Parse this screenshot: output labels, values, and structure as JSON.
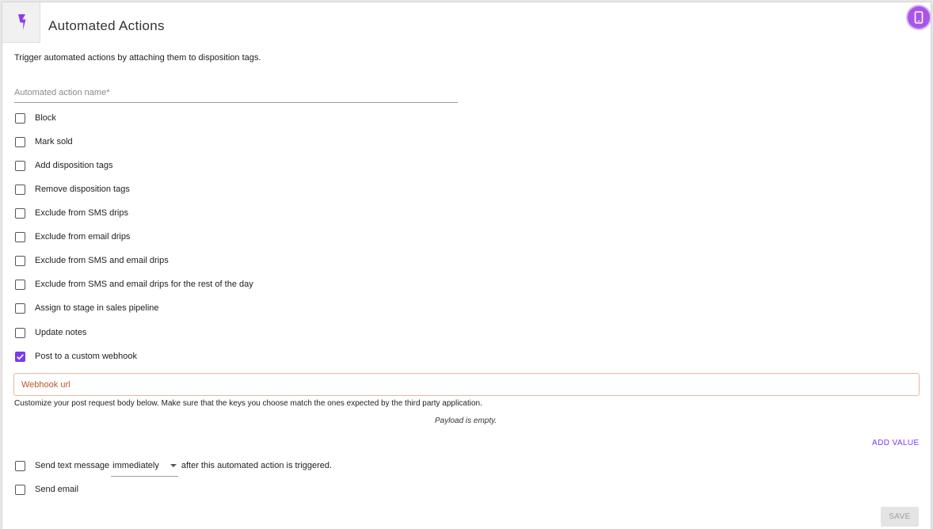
{
  "header": {
    "title": "Automated Actions",
    "icon": "lightning-bolt-icon",
    "phone_icon": "mobile-phone-icon",
    "accent_color": "#7c3aed"
  },
  "description": "Trigger automated actions by attaching them to disposition tags.",
  "name_field": {
    "placeholder": "Automated action name",
    "required_marker": "*"
  },
  "options": [
    {
      "label": "Block",
      "checked": false
    },
    {
      "label": "Mark sold",
      "checked": false
    },
    {
      "label": "Add disposition tags",
      "checked": false
    },
    {
      "label": "Remove disposition tags",
      "checked": false
    },
    {
      "label": "Exclude from SMS drips",
      "checked": false
    },
    {
      "label": "Exclude from email drips",
      "checked": false
    },
    {
      "label": "Exclude from SMS and email drips",
      "checked": false
    },
    {
      "label": "Exclude from SMS and email drips for the rest of the day",
      "checked": false
    },
    {
      "label": "Assign to stage in sales pipeline",
      "checked": false
    },
    {
      "label": "Update notes",
      "checked": false
    },
    {
      "label": "Post to a custom webhook",
      "checked": true
    }
  ],
  "webhook": {
    "placeholder": "Webhook url",
    "hint": "Customize your post request body below. Make sure that the keys you choose match the ones expected by the third party application.",
    "empty_payload": "Payload is empty.",
    "add_value_label": "ADD VALUE"
  },
  "send_text": {
    "label_before": "Send text message",
    "timing_value": "immediately",
    "label_after": "after this automated action is triggered.",
    "checked": false
  },
  "send_email": {
    "label": "Send email",
    "checked": false
  },
  "save_label": "SAVE"
}
